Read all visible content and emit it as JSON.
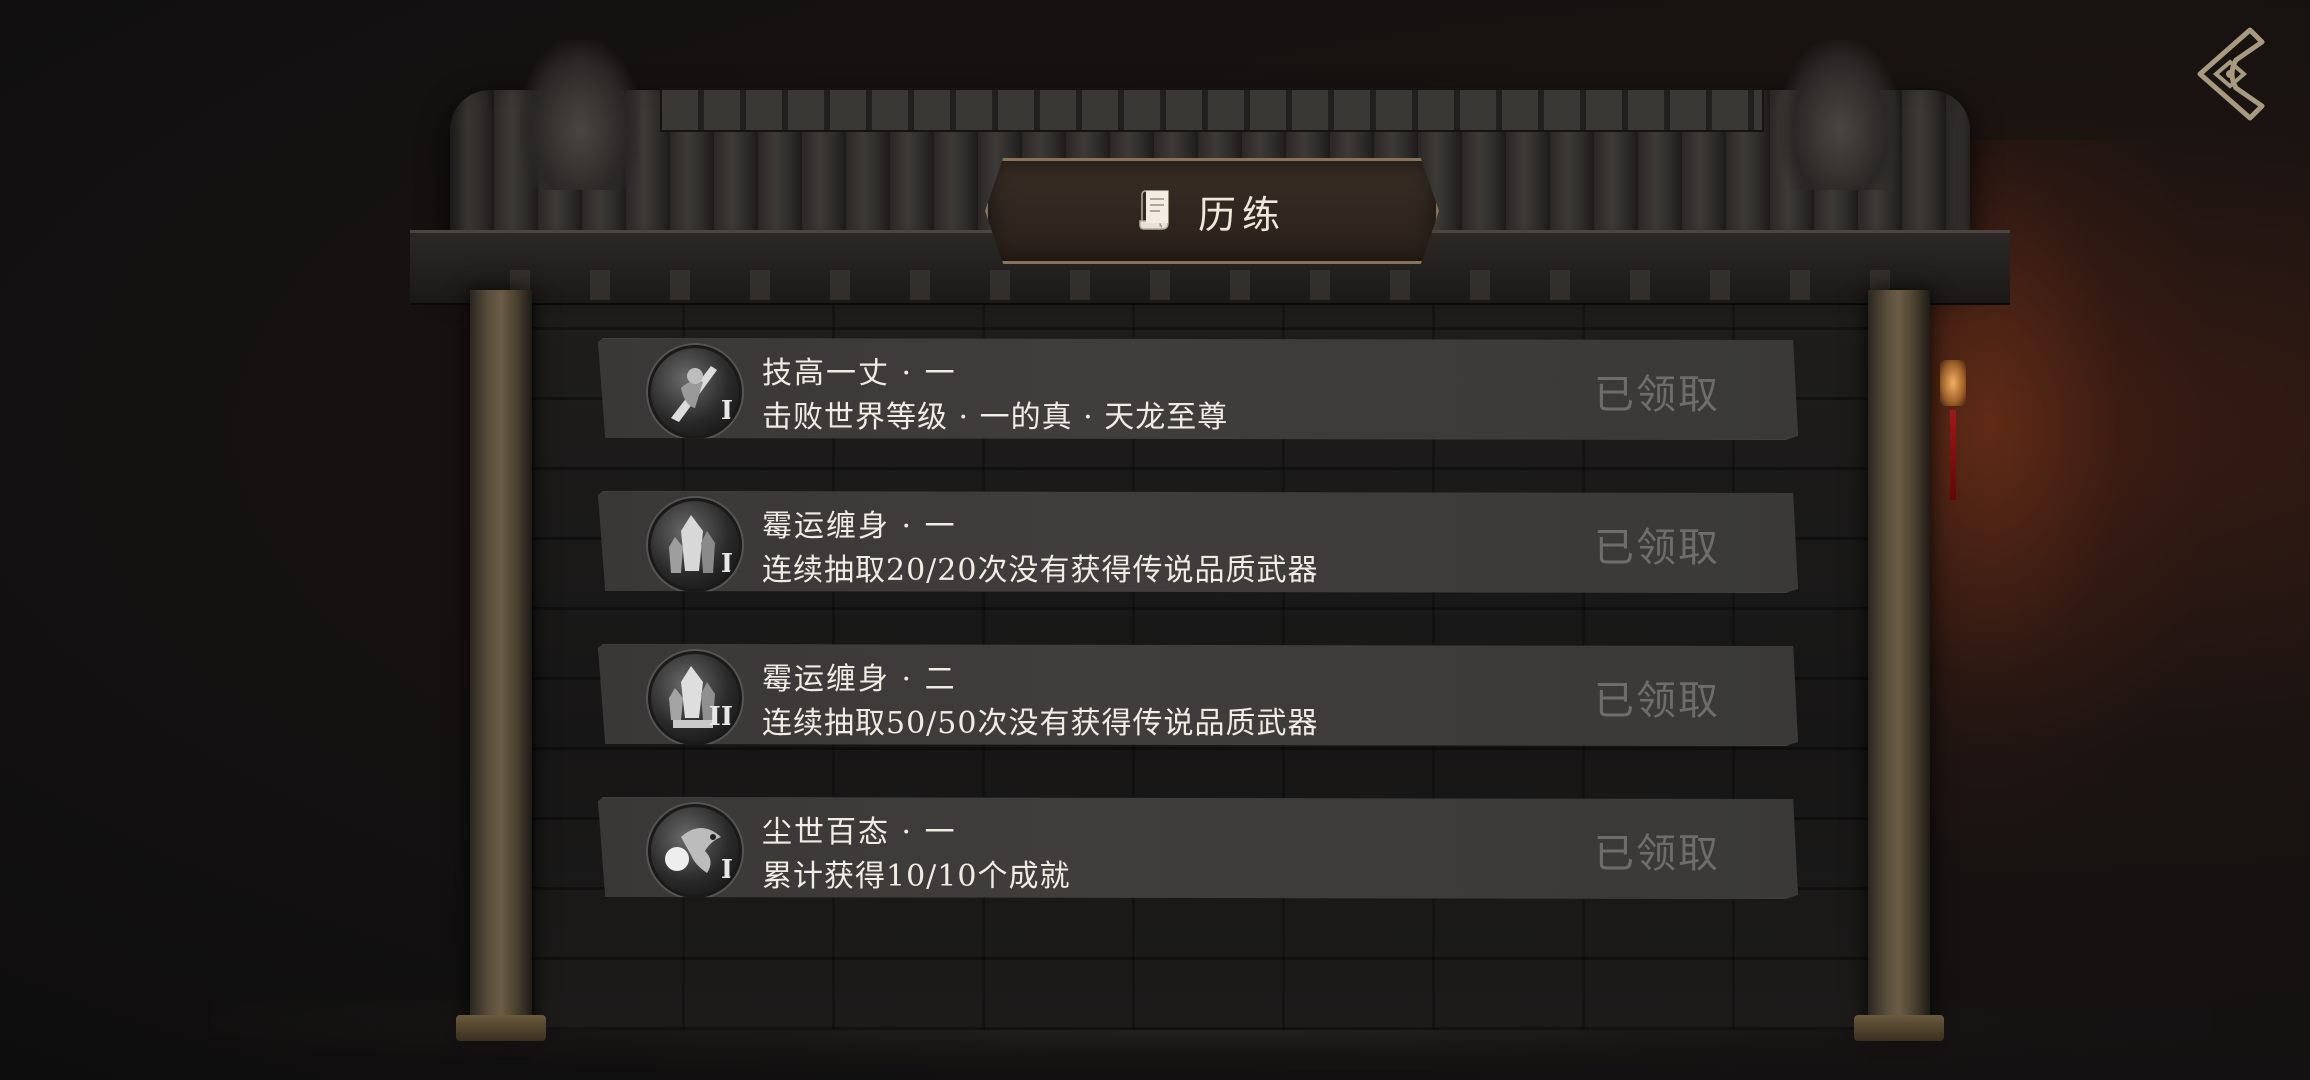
{
  "header": {
    "title": "历练"
  },
  "achievements": [
    {
      "title": "技高一丈 · 一",
      "description": "击败世界等级 · 一的真 · 天龙至尊",
      "tier": "I",
      "status": "已领取",
      "icon": "sword-warrior-icon"
    },
    {
      "title": "霉运缠身 · 一",
      "description": "连续抽取20/20次没有获得传说品质武器",
      "tier": "I",
      "status": "已领取",
      "icon": "crystal-icon"
    },
    {
      "title": "霉运缠身 · 二",
      "description": "连续抽取50/50次没有获得传说品质武器",
      "tier": "II",
      "status": "已领取",
      "icon": "crystal-icon"
    },
    {
      "title": "尘世百态 · 一",
      "description": "累计获得10/10个成就",
      "tier": "I",
      "status": "已领取",
      "icon": "dragon-pearl-icon"
    }
  ],
  "colors": {
    "status_claimed": "#6f6d6a",
    "row_bg": "#3d3b3a",
    "plaque_border": "#8a7258"
  }
}
